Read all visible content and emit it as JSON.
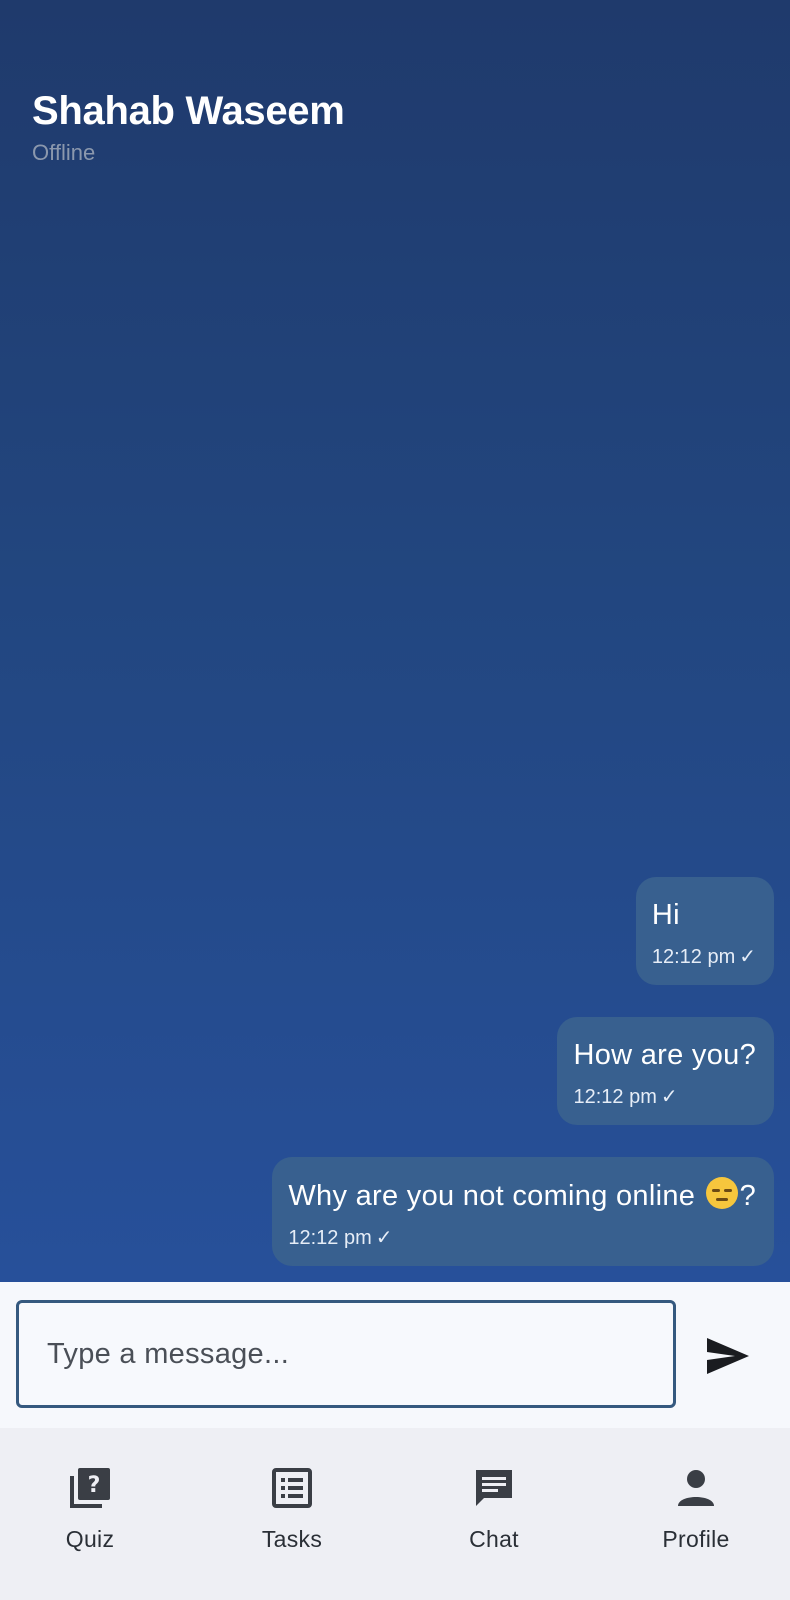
{
  "colors": {
    "chat_bg_top": "#1f3a6c",
    "chat_bg_bottom": "#27509a",
    "bubble": "#38608f",
    "input_border": "#35597f",
    "nav_bg": "#eeeff4"
  },
  "header": {
    "name": "Shahab Waseem",
    "status": "Offline"
  },
  "messages": [
    {
      "text": "Hi",
      "time": "12:12 pm",
      "status_icon": "✓"
    },
    {
      "text": "How are you?",
      "time": "12:12 pm",
      "status_icon": "✓"
    },
    {
      "text_before": "Why are you not coming online ",
      "emoji": "pensive-face-emoji",
      "text_after": "?",
      "time": "12:12 pm",
      "status_icon": "✓"
    }
  ],
  "composer": {
    "placeholder": "Type a message...",
    "value": "",
    "send_icon": "send-icon"
  },
  "nav": {
    "items": [
      {
        "label": "Quiz",
        "icon": "quiz-icon"
      },
      {
        "label": "Tasks",
        "icon": "list-icon"
      },
      {
        "label": "Chat",
        "icon": "chat-icon"
      },
      {
        "label": "Profile",
        "icon": "person-icon"
      }
    ]
  }
}
